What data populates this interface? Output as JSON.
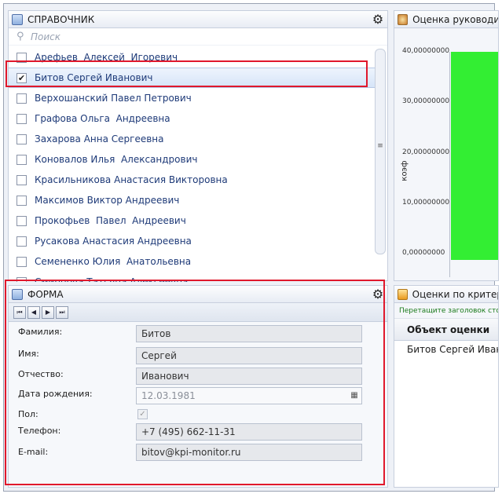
{
  "directory": {
    "title": "СПРАВОЧНИК",
    "search_placeholder": "Поиск",
    "items": [
      {
        "label": "Арефьев  Алексей  Игоревич",
        "checked": false
      },
      {
        "label": "Битов Сергей Иванович",
        "checked": true
      },
      {
        "label": "Верхошанский Павел Петрович",
        "checked": false
      },
      {
        "label": "Графова Ольга  Андреевна",
        "checked": false
      },
      {
        "label": "Захарова Анна Сергеевна",
        "checked": false
      },
      {
        "label": "Коновалов Илья  Александрович",
        "checked": false
      },
      {
        "label": "Красильникова Анастасия Викторовна",
        "checked": false
      },
      {
        "label": "Максимов Виктор Андреевич",
        "checked": false
      },
      {
        "label": "Прокофьев  Павел  Андреевич",
        "checked": false
      },
      {
        "label": "Русакова Анастасия Андреевна",
        "checked": false
      },
      {
        "label": "Семененко Юлия  Анатольевна",
        "checked": false
      },
      {
        "label": "Смирнова Татьяна Алексеевна",
        "checked": false
      }
    ]
  },
  "chart_panel": {
    "title": "Оценка руководит",
    "chart_data": {
      "type": "bar",
      "ylabel": "коэф",
      "yticks": [
        "40,00000000",
        "30,00000000",
        "20,00000000",
        "10,00000000",
        "0,00000000"
      ],
      "ylim": [
        0,
        40
      ],
      "values": [
        40
      ]
    }
  },
  "form": {
    "title": "ФОРМА",
    "fields": {
      "surname_label": "Фамилия:",
      "surname": "Битов",
      "name_label": "Имя:",
      "name": "Сергей",
      "patronymic_label": "Отчество:",
      "patronymic": "Иванович",
      "birthdate_label": "Дата рождения:",
      "birthdate": "12.03.1981",
      "gender_label": "Пол:",
      "gender_checked": true,
      "phone_label": "Телефон:",
      "phone": "+7 (495) 662-11-31",
      "email_label": "E-mail:",
      "email": "bitov@kpi-monitor.ru"
    }
  },
  "eval_panel": {
    "title": "Оценки по критери",
    "hint": "Перетащите заголовок стол",
    "column_header": "Объект оценки",
    "rows": [
      "Битов Сергей Иванов"
    ]
  },
  "colors": {
    "accent_red": "#e0182c",
    "bar_green": "#33ee33"
  }
}
